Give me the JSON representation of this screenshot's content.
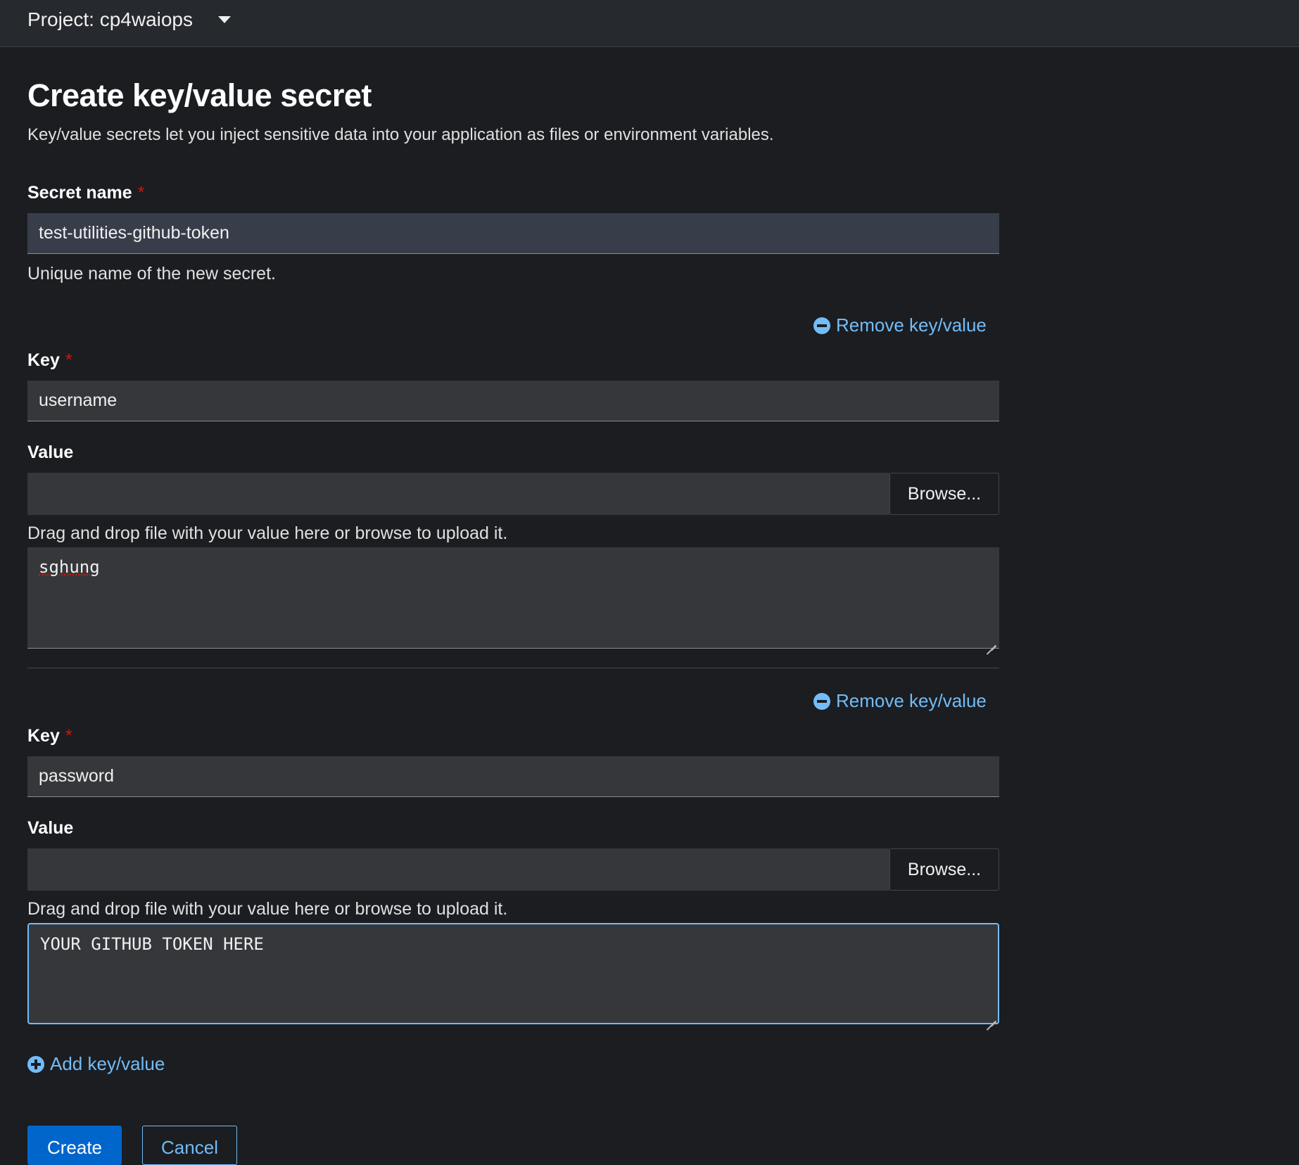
{
  "header": {
    "project_label": "Project: cp4waiops"
  },
  "page": {
    "title": "Create key/value secret",
    "description": "Key/value secrets let you inject sensitive data into your application as files or environment variables."
  },
  "secret_name": {
    "label": "Secret name",
    "required_marker": "*",
    "value": "test-utilities-github-token",
    "helper": "Unique name of the new secret."
  },
  "pairs": [
    {
      "remove_label": "Remove key/value",
      "key_label": "Key",
      "required_marker": "*",
      "key_value": "username",
      "value_label": "Value",
      "browse_label": "Browse...",
      "file_helper": "Drag and drop file with your value here or browse to upload it.",
      "value_text": "sghung"
    },
    {
      "remove_label": "Remove key/value",
      "key_label": "Key",
      "required_marker": "*",
      "key_value": "password",
      "value_label": "Value",
      "browse_label": "Browse...",
      "file_helper": "Drag and drop file with your value here or browse to upload it.",
      "value_text": "YOUR GITHUB TOKEN HERE"
    }
  ],
  "actions": {
    "add_label": "Add key/value",
    "create_label": "Create",
    "cancel_label": "Cancel"
  },
  "colors": {
    "accent": "#73bcf7",
    "primary": "#0066cc",
    "required": "#c9190b",
    "background": "#1b1d21"
  },
  "icons": {
    "remove": "minus-circle-icon",
    "add": "plus-circle-icon",
    "caret": "caret-down-icon"
  }
}
